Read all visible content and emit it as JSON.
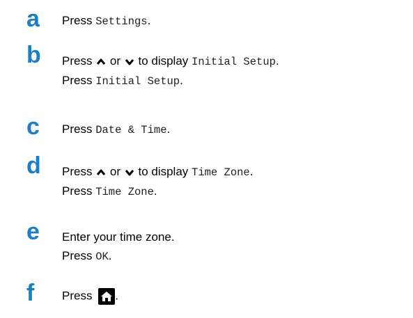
{
  "steps": [
    {
      "letter": "a",
      "lines": [
        {
          "t1": "Press ",
          "m1": "Settings",
          "t2": "."
        }
      ]
    },
    {
      "letter": "b",
      "lines": [
        {
          "t1": "Press ",
          "or": " or ",
          "t2": " to display ",
          "m1": "Initial Setup",
          "t3": "."
        },
        {
          "t1": "Press ",
          "m1": "Initial Setup",
          "t2": "."
        }
      ]
    },
    {
      "letter": "c",
      "lines": [
        {
          "t1": "Press ",
          "m1": "Date & Time",
          "t2": "."
        }
      ]
    },
    {
      "letter": "d",
      "lines": [
        {
          "t1": "Press ",
          "or": " or ",
          "t2": " to display ",
          "m1": "Time Zone",
          "t3": "."
        },
        {
          "t1": "Press ",
          "m1": "Time Zone",
          "t2": "."
        }
      ]
    },
    {
      "letter": "e",
      "lines": [
        {
          "t1": "Enter your time zone."
        },
        {
          "t1": "Press ",
          "m1": "OK",
          "t2": "."
        }
      ]
    },
    {
      "letter": "f",
      "lines": [
        {
          "t1": "Press ",
          "t2": "."
        }
      ]
    }
  ],
  "icons": {
    "up": "up-chevron-icon",
    "down": "down-chevron-icon",
    "home": "home-icon"
  },
  "colors": {
    "step_letter": "#1c7fc6",
    "text": "#000000"
  }
}
